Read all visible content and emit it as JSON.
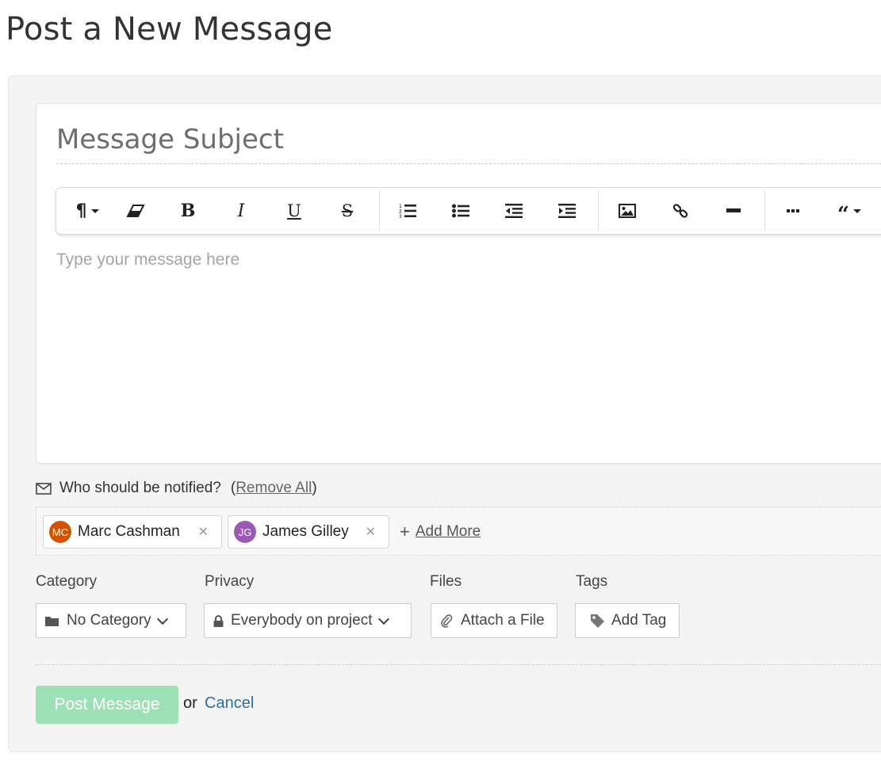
{
  "page": {
    "title": "Post a New Message"
  },
  "editor": {
    "subject_placeholder": "Message Subject",
    "body_placeholder": "Type your message here",
    "toolbar": [
      "paragraph-format-icon",
      "clear-formatting-icon",
      "bold-icon",
      "italic-icon",
      "underline-icon",
      "strikethrough-icon",
      "ordered-list-icon",
      "unordered-list-icon",
      "outdent-icon",
      "indent-icon",
      "insert-image-icon",
      "insert-link-icon",
      "horizontal-rule-icon",
      "more-icon",
      "quote-icon"
    ]
  },
  "notify": {
    "label": "Who should be notified?",
    "open_paren": "(",
    "remove_all": "Remove All",
    "close_paren": ")",
    "recipients": [
      {
        "initials": "MC",
        "name": "Marc Cashman",
        "color": "#d35400"
      },
      {
        "initials": "JG",
        "name": "James Gilley",
        "color": "#9b59b6"
      }
    ],
    "add_more": "Add More"
  },
  "fields": {
    "category": {
      "label": "Category",
      "value": "No Category"
    },
    "privacy": {
      "label": "Privacy",
      "value": "Everybody on project"
    },
    "files": {
      "label": "Files",
      "button": "Attach a File"
    },
    "tags": {
      "label": "Tags",
      "button": "Add Tag"
    }
  },
  "actions": {
    "post": "Post Message",
    "or": "or",
    "cancel": "Cancel",
    "post_color": "#9ee0b5",
    "cancel_color": "#2f6ea2"
  }
}
